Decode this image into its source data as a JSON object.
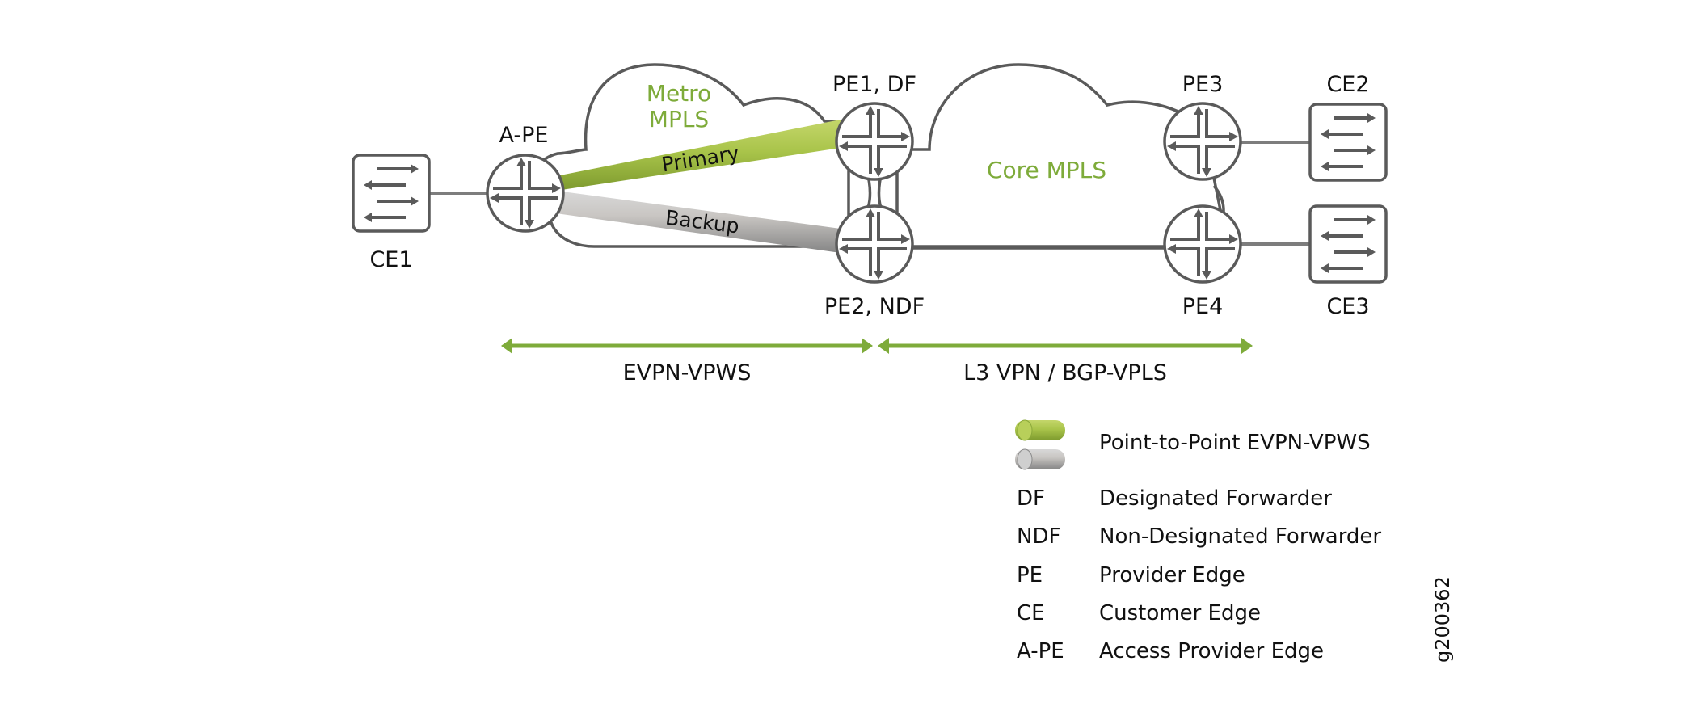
{
  "clouds": {
    "metro": {
      "line1": "Metro",
      "line2": "MPLS"
    },
    "core": {
      "label": "Core MPLS"
    }
  },
  "nodes": {
    "ce1": {
      "label": "CE1",
      "type": "switch"
    },
    "ape": {
      "label": "A-PE",
      "type": "router"
    },
    "pe1": {
      "label": "PE1, DF",
      "type": "router"
    },
    "pe2": {
      "label": "PE2, NDF",
      "type": "router"
    },
    "pe3": {
      "label": "PE3",
      "type": "router"
    },
    "pe4": {
      "label": "PE4",
      "type": "router"
    },
    "ce2": {
      "label": "CE2",
      "type": "switch"
    },
    "ce3": {
      "label": "CE3",
      "type": "switch"
    }
  },
  "tunnels": {
    "primary": {
      "label": "Primary",
      "from": "A-PE",
      "to": "PE1, DF",
      "color": "#a9c44a"
    },
    "backup": {
      "label": "Backup",
      "from": "A-PE",
      "to": "PE2, NDF",
      "color": "#b9b9b9"
    }
  },
  "spans": [
    {
      "label": "EVPN-VPWS",
      "from": "A-PE",
      "to": "PE1/PE2"
    },
    {
      "label": "L3 VPN / BGP-VPLS",
      "from": "PE1/PE2",
      "to": "PE3/PE4"
    }
  ],
  "legend": {
    "tube_label": "Point-to-Point EVPN-VPWS",
    "entries": [
      {
        "abbr": "DF",
        "desc": "Designated Forwarder"
      },
      {
        "abbr": "NDF",
        "desc": "Non-Designated Forwarder"
      },
      {
        "abbr": "PE",
        "desc": "Provider Edge"
      },
      {
        "abbr": "CE",
        "desc": "Customer Edge"
      },
      {
        "abbr": "A-PE",
        "desc": "Access Provider Edge"
      }
    ]
  },
  "figure_id": "g200362",
  "colors": {
    "accent_green": "#7eab3a",
    "primary_tube": "#a9c44a",
    "backup_tube": "#b9b9b9",
    "outline": "#5a5a5a"
  }
}
